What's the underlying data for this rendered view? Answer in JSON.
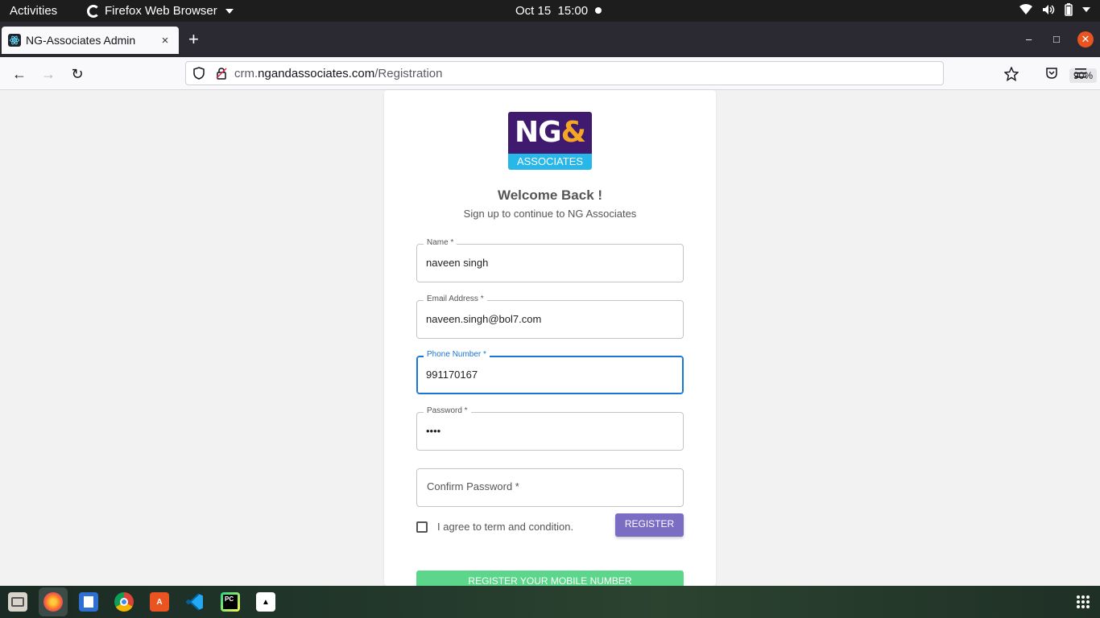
{
  "system": {
    "activities": "Activities",
    "app_name": "Firefox Web Browser",
    "date": "Oct 15",
    "time": "15:00"
  },
  "browser": {
    "tab_title": "NG-Associates Admin",
    "tab_close": "×",
    "new_tab": "+",
    "url_domain_prefix": "crm.",
    "url_domain": "ngandassociates.com",
    "url_path": "/Registration",
    "zoom": "90%"
  },
  "page": {
    "logo_main": "NG",
    "logo_amp": "&",
    "logo_sub": "ASSOCIATES",
    "welcome": "Welcome Back !",
    "subtitle": "Sign up to continue to NG Associates",
    "fields": {
      "name": {
        "label": "Name *",
        "value": "naveen singh"
      },
      "email": {
        "label": "Email Address *",
        "value": "naveen.singh@bol7.com"
      },
      "phone": {
        "label": "Phone Number *",
        "value": "991170167"
      },
      "password": {
        "label": "Password *",
        "value": "••••"
      },
      "confirm": {
        "placeholder": "Confirm Password *"
      }
    },
    "agree_text": "I agree to term and condition.",
    "register_button": "REGISTER",
    "mobile_button": "REGISTER YOUR MOBILE NUMBER"
  },
  "colors": {
    "accent": "#1976d2",
    "register": "#7b6cc4",
    "mobile": "#5cd68a",
    "logo_purple": "#3f1a6e",
    "logo_blue": "#27b7e8",
    "logo_orange": "#f5a623"
  },
  "dock_icons": [
    "files-icon",
    "firefox-icon",
    "text-editor-icon",
    "chrome-icon",
    "software-center-icon",
    "vscode-icon",
    "pycharm-icon",
    "inkscape-icon",
    "show-apps-icon"
  ]
}
